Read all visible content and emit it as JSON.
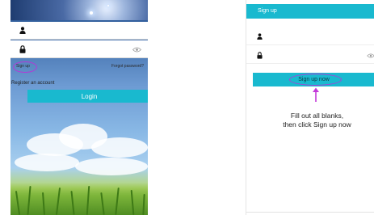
{
  "login_screen": {
    "username_placeholder": "",
    "password_placeholder": "",
    "sign_up_link": "Sign up",
    "forgot_password_link": "Forgot password?",
    "register_text": "Register an account",
    "login_button": "Login"
  },
  "signup_screen": {
    "title": "Sign up",
    "username_placeholder": "",
    "password_placeholder": "",
    "sign_up_button": "Sign up now"
  },
  "annotation": {
    "line1": "Fill out all blanks,",
    "line2": "then click Sign up now"
  },
  "colors": {
    "accent": "#19b9cf",
    "highlight": "#b03cd6"
  },
  "icons": [
    "user-icon",
    "lock-icon",
    "eye-icon",
    "arrow-up-icon"
  ]
}
